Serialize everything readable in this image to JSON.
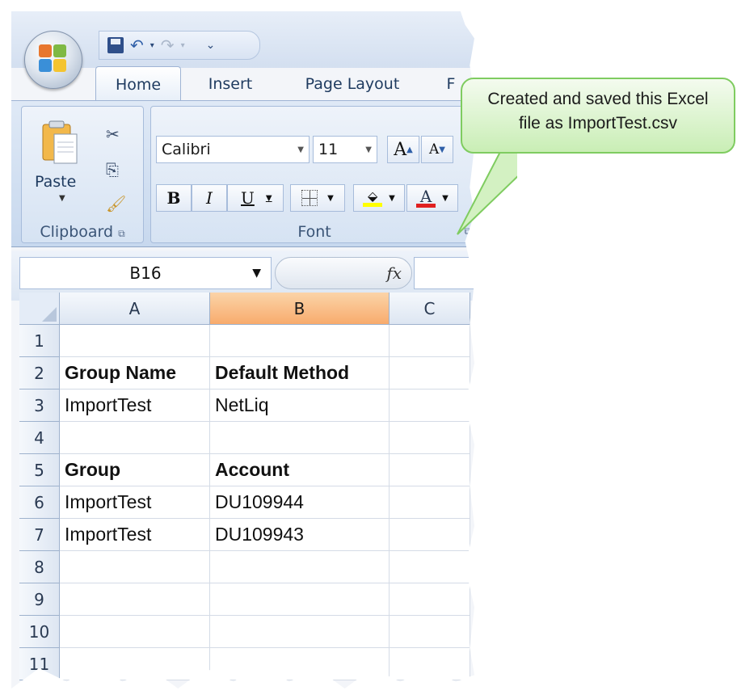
{
  "quick_access": {
    "save_icon": "save-icon",
    "undo_icon": "undo-icon",
    "redo_icon": "redo-icon",
    "customize_symbol": "⌄"
  },
  "tabs": [
    {
      "label": "Home",
      "active": true
    },
    {
      "label": "Insert",
      "active": false
    },
    {
      "label": "Page Layout",
      "active": false
    },
    {
      "label": "F",
      "active": false
    }
  ],
  "ribbon": {
    "clipboard": {
      "paste_label": "Paste",
      "group_label": "Clipboard"
    },
    "font": {
      "font_name": "Calibri",
      "font_size": "11",
      "bold_label": "B",
      "italic_label": "I",
      "underline_label": "U",
      "group_label": "Font"
    }
  },
  "formula_bar": {
    "name_box": "B16",
    "fx_label": "fx",
    "content": ""
  },
  "grid": {
    "columns": [
      "A",
      "B",
      "C"
    ],
    "selected_column": "B",
    "rows": [
      {
        "num": "1",
        "cells": [
          "",
          "",
          ""
        ]
      },
      {
        "num": "2",
        "cells": [
          "Group Name",
          "Default Method",
          ""
        ],
        "bold": true
      },
      {
        "num": "3",
        "cells": [
          "ImportTest",
          "NetLiq",
          ""
        ]
      },
      {
        "num": "4",
        "cells": [
          "",
          "",
          ""
        ]
      },
      {
        "num": "5",
        "cells": [
          "Group",
          "Account",
          ""
        ],
        "bold": true
      },
      {
        "num": "6",
        "cells": [
          "ImportTest",
          "DU109944",
          ""
        ]
      },
      {
        "num": "7",
        "cells": [
          "ImportTest",
          "DU109943",
          ""
        ]
      },
      {
        "num": "8",
        "cells": [
          "",
          "",
          ""
        ]
      },
      {
        "num": "9",
        "cells": [
          "",
          "",
          ""
        ]
      },
      {
        "num": "10",
        "cells": [
          "",
          "",
          ""
        ]
      },
      {
        "num": "11",
        "cells": [
          "",
          "",
          ""
        ]
      }
    ]
  },
  "callout": {
    "line1": "Created and saved this Excel",
    "line2": "file as ImportTest.csv"
  },
  "colors": {
    "selected_header": "#f8ab6d",
    "callout_fill": "#c9eeb5",
    "callout_border": "#7fcc60"
  }
}
